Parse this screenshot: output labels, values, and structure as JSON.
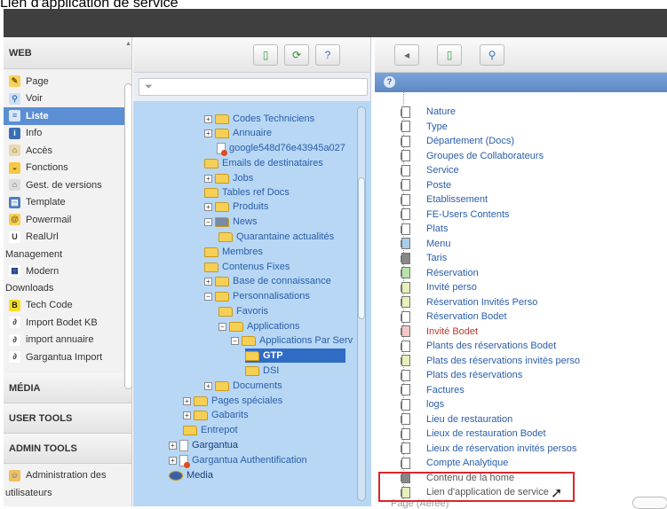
{
  "window_title": "Lien d'application de service",
  "module_menu": {
    "web_label": "WEB",
    "web_items": [
      {
        "label": "Page",
        "icon": "page-edit-icon"
      },
      {
        "label": "Voir",
        "icon": "magnifier-icon"
      },
      {
        "label": "Liste",
        "icon": "list-icon"
      },
      {
        "label": "Info",
        "icon": "info-icon"
      },
      {
        "label": "Accès",
        "icon": "access-icon"
      },
      {
        "label": "Fonctions",
        "icon": "functions-icon"
      },
      {
        "label": "Gest. de versions",
        "icon": "versions-icon"
      },
      {
        "label": "Template",
        "icon": "template-icon"
      },
      {
        "label": "Powermail",
        "icon": "powermail-icon"
      },
      {
        "label": "RealUrl",
        "icon": "realurl-icon"
      },
      {
        "label": "Management",
        "icon": ""
      },
      {
        "label": "Modern",
        "icon": "modern-icon"
      },
      {
        "label": "Downloads",
        "icon": ""
      },
      {
        "label": "Tech Code",
        "icon": "techcode-icon"
      },
      {
        "label": "Import Bodet KB",
        "icon": "import-icon"
      },
      {
        "label": "import annuaire",
        "icon": "import-icon"
      },
      {
        "label": "Gargantua Import",
        "icon": "import-icon"
      }
    ],
    "media_label": "MÉDIA",
    "user_tools_label": "USER TOOLS",
    "admin_tools_label": "ADMIN TOOLS",
    "admin_items": [
      {
        "label": "Administration des",
        "icon": "admin-users-icon"
      },
      {
        "label": "utilisateurs",
        "icon": ""
      }
    ]
  },
  "tree": {
    "filter_placeholder": "",
    "nodes": [
      {
        "label": "Codes Techniciens",
        "type": "folder",
        "pm": "+"
      },
      {
        "label": "Annuaire",
        "type": "folder",
        "pm": "+"
      },
      {
        "label": "google548d76e43945a027",
        "type": "page-red",
        "pm": ""
      },
      {
        "label": "Emails de destinataires",
        "type": "folder",
        "pm": ""
      },
      {
        "label": "Jobs",
        "type": "folder",
        "pm": "+"
      },
      {
        "label": "Tables ref Docs",
        "type": "folder",
        "pm": ""
      },
      {
        "label": "Produits",
        "type": "folder",
        "pm": "+"
      },
      {
        "label": "News",
        "type": "news",
        "pm": "-"
      },
      {
        "label": "Quarantaine actualités",
        "type": "folder",
        "pm": ""
      },
      {
        "label": "Membres",
        "type": "folder",
        "pm": ""
      },
      {
        "label": "Contenus Fixes",
        "type": "folder",
        "pm": ""
      },
      {
        "label": "Base de connaissance",
        "type": "folder",
        "pm": "+"
      },
      {
        "label": "Personnalisations",
        "type": "folder",
        "pm": "-"
      },
      {
        "label": "Favoris",
        "type": "folder",
        "pm": ""
      },
      {
        "label": "Applications",
        "type": "folder",
        "pm": "-"
      },
      {
        "label": "Applications Par Serv",
        "type": "folder",
        "pm": "-"
      },
      {
        "label": "GTP",
        "type": "folder",
        "pm": ""
      },
      {
        "label": "DSI",
        "type": "folder",
        "pm": ""
      },
      {
        "label": "Documents",
        "type": "folder",
        "pm": "+"
      },
      {
        "label": "Pages spéciales",
        "type": "folder",
        "pm": "+"
      },
      {
        "label": "Gabarits",
        "type": "folder",
        "pm": "+"
      },
      {
        "label": "Entrepot",
        "type": "folder",
        "pm": ""
      },
      {
        "label": "Gargantua",
        "type": "page",
        "pm": "+"
      },
      {
        "label": "Gargantua Authentification",
        "type": "page-red",
        "pm": "+"
      },
      {
        "label": "Media",
        "type": "media",
        "pm": ""
      }
    ]
  },
  "list": {
    "records": [
      {
        "label": "Nature",
        "color": ""
      },
      {
        "label": "Type",
        "color": ""
      },
      {
        "label": "Département (Docs)",
        "color": ""
      },
      {
        "label": "Groupes de Collaborateurs",
        "color": ""
      },
      {
        "label": "Service",
        "color": ""
      },
      {
        "label": "Poste",
        "color": ""
      },
      {
        "label": "Etablissement",
        "color": ""
      },
      {
        "label": "FE-Users Contents",
        "color": ""
      },
      {
        "label": "Plats",
        "color": ""
      },
      {
        "label": "Menu",
        "color": "#a9cde8"
      },
      {
        "label": "Taris",
        "color": "#888888"
      },
      {
        "label": "Réservation",
        "color": "#b7e3a8"
      },
      {
        "label": "Invité perso",
        "color": "#e6f0b8"
      },
      {
        "label": "Réservation Invités Perso",
        "color": "#e6f0b8"
      },
      {
        "label": "Réservation Bodet",
        "color": ""
      },
      {
        "label": "Invité Bodet",
        "color": "#f3c7c7"
      },
      {
        "label": "Plants des réservations Bodet",
        "color": ""
      },
      {
        "label": "Plats des réservations invités perso",
        "color": "#e6f0b8"
      },
      {
        "label": "Plats des réservations",
        "color": ""
      },
      {
        "label": "Factures",
        "color": ""
      },
      {
        "label": "logs",
        "color": ""
      },
      {
        "label": "Lieu de restauration",
        "color": ""
      },
      {
        "label": "Lieux de restauration Bodet",
        "color": ""
      },
      {
        "label": "Lieux de réservation invités persos",
        "color": ""
      },
      {
        "label": "Compte Analytique",
        "color": ""
      },
      {
        "label": "Contenu de la home",
        "color": "#888888"
      },
      {
        "label": "Lien d'application de service",
        "color": "#e6f0b8"
      }
    ],
    "bottom_label": "Page (Aérée)"
  },
  "colors": {
    "accent": "#5b8ed3",
    "tree_background": "#b7d7f5",
    "selection": "#2f6cc4",
    "highlight_border": "#d9262b"
  }
}
